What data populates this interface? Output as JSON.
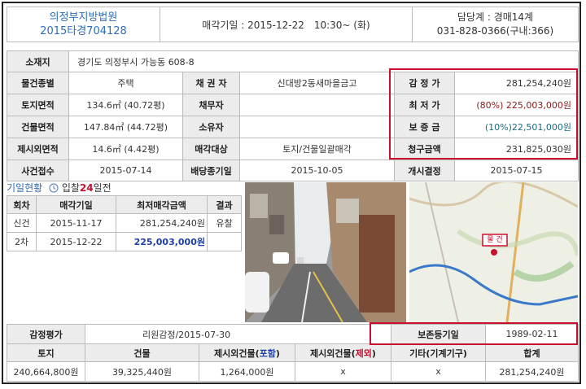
{
  "header": {
    "court": "의정부지방법원",
    "case_no": "2015타경704128",
    "sale_date": "매각기일 : 2015-12-22　10:30~ (화)",
    "dept": "담당계 : 경매14계",
    "phone": "031-828-0366(구내:366)"
  },
  "location": {
    "label": "소재지",
    "value": "경기도 의정부시 가능동 608-8"
  },
  "details": {
    "type_label": "물건종별",
    "type_value": "주택",
    "creditor_label": "채 권 자",
    "creditor_value": "신대방2동새마을금고",
    "appraisal_label": "감 정 가",
    "appraisal_value": "281,254,240원",
    "land_label": "토지면적",
    "land_value": "134.6㎡ (40.72평)",
    "debtor_label": "채무자",
    "debtor_value": "",
    "min_label": "최 저 가",
    "min_value": "(80%) 225,003,000원",
    "bldg_label": "건물면적",
    "bldg_value": "147.84㎡ (44.72평)",
    "owner_label": "소유자",
    "owner_value": "",
    "deposit_label": "보 증 금",
    "deposit_value": "(10%)22,501,000원",
    "excl_label": "제시외면적",
    "excl_value": "14.6㎡ (4.42평)",
    "target_label": "매각대상",
    "target_value": "토지/건물일괄매각",
    "claim_label": "청구금액",
    "claim_value": "231,825,030원",
    "received_label": "사건접수",
    "received_value": "2015-07-14",
    "deadline_label": "배당종기일",
    "deadline_value": "2015-10-05",
    "start_label": "개시결정",
    "start_value": "2015-07-15"
  },
  "history": {
    "title": "기일현황",
    "clock_icon": "clock-icon",
    "notice_prefix": "입찰",
    "notice_days": "24",
    "notice_suffix": "일전",
    "columns": [
      "회차",
      "매각기일",
      "최저매각금액",
      "결과"
    ],
    "rows": [
      {
        "round": "신건",
        "date": "2015-11-17",
        "amount": "281,254,240원",
        "result": "유찰"
      },
      {
        "round": "2차",
        "date": "2015-12-22",
        "amount": "225,003,000원",
        "result": ""
      }
    ]
  },
  "map": {
    "marker": "물 건"
  },
  "bottom": {
    "appraisal_label": "감정평가",
    "appraisal_value": "리원감정/2015-07-30",
    "reg_label": "보존등기일",
    "reg_value": "1989-02-11",
    "columns": {
      "land": "토지",
      "bldg": "건물",
      "excl_in_pre": "제시외건물(",
      "excl_in_mid": "포함",
      "excl_in_post": ")",
      "excl_out_pre": "제시외건물(",
      "excl_out_mid": "제외",
      "excl_out_post": ")",
      "etc": "기타(기계기구)",
      "total": "합계"
    },
    "values": {
      "land": "240,664,800원",
      "bldg": "39,325,440원",
      "excl_in": "1,264,000원",
      "excl_out": "x",
      "etc": "x",
      "total": "281,254,240원"
    }
  },
  "colors": {
    "accent_red": "#c8102e",
    "court_blue": "#2e6db5",
    "label_bg": "#ececec"
  }
}
